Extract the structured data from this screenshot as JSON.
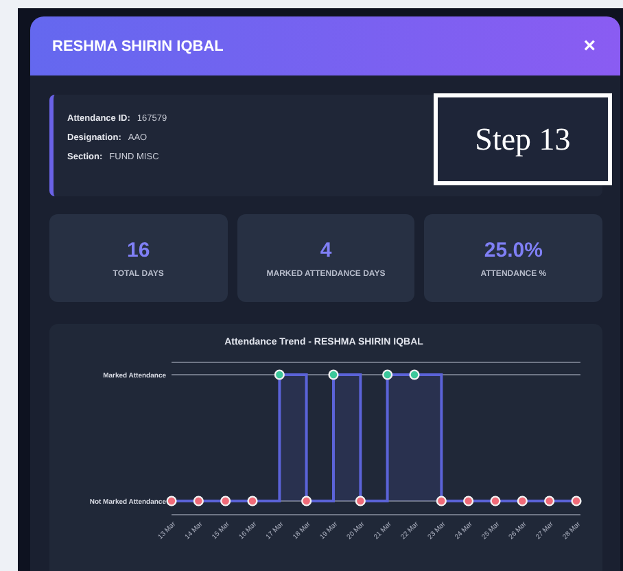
{
  "modal": {
    "title": "RESHMA SHIRIN IQBAL",
    "close": "×"
  },
  "info": [
    {
      "label": "Attendance ID:",
      "value": "167579"
    },
    {
      "label": "Designation:",
      "value": "AAO"
    },
    {
      "label": "Section:",
      "value": "FUND MISC"
    }
  ],
  "stats": [
    {
      "value": "16",
      "label": "TOTAL DAYS"
    },
    {
      "value": "4",
      "label": "MARKED ATTENDANCE DAYS"
    },
    {
      "value": "25.0%",
      "label": "ATTENDANCE %"
    }
  ],
  "chart": {
    "title": "Attendance Trend - RESHMA SHIRIN IQBAL",
    "y_labels": [
      "Marked Attendance",
      "Not Marked Attendance"
    ],
    "days": [
      {
        "label": "13 Mar",
        "marked": false
      },
      {
        "label": "14 Mar",
        "marked": false
      },
      {
        "label": "15 Mar",
        "marked": false
      },
      {
        "label": "16 Mar",
        "marked": false
      },
      {
        "label": "17 Mar",
        "marked": true
      },
      {
        "label": "18 Mar",
        "marked": false
      },
      {
        "label": "19 Mar",
        "marked": true
      },
      {
        "label": "20 Mar",
        "marked": false
      },
      {
        "label": "21 Mar",
        "marked": true
      },
      {
        "label": "22 Mar",
        "marked": true
      },
      {
        "label": "23 Mar",
        "marked": false
      },
      {
        "label": "24 Mar",
        "marked": false
      },
      {
        "label": "25 Mar",
        "marked": false
      },
      {
        "label": "26 Mar",
        "marked": false
      },
      {
        "label": "27 Mar",
        "marked": false
      },
      {
        "label": "28 Mar",
        "marked": false
      }
    ]
  },
  "annotation": {
    "text": "Step 13"
  }
}
